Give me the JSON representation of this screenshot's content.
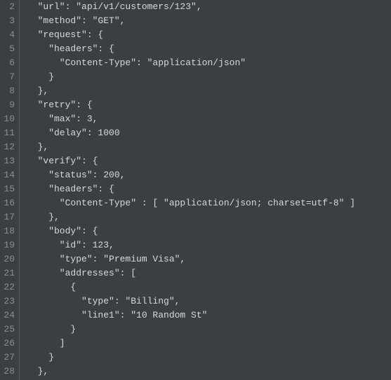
{
  "first_line_number": 2,
  "lines": [
    {
      "indent": 1,
      "text": "\"url\": \"api/v1/customers/123\","
    },
    {
      "indent": 1,
      "text": "\"method\": \"GET\","
    },
    {
      "indent": 1,
      "text": "\"request\": {"
    },
    {
      "indent": 2,
      "text": "\"headers\": {"
    },
    {
      "indent": 3,
      "text": "\"Content-Type\": \"application/json\""
    },
    {
      "indent": 2,
      "text": "}"
    },
    {
      "indent": 1,
      "text": "},"
    },
    {
      "indent": 1,
      "text": "\"retry\": {"
    },
    {
      "indent": 2,
      "text": "\"max\": 3,"
    },
    {
      "indent": 2,
      "text": "\"delay\": 1000"
    },
    {
      "indent": 1,
      "text": "},"
    },
    {
      "indent": 1,
      "text": "\"verify\": {"
    },
    {
      "indent": 2,
      "text": "\"status\": 200,"
    },
    {
      "indent": 2,
      "text": "\"headers\": {"
    },
    {
      "indent": 3,
      "text": "\"Content-Type\" : [ \"application/json; charset=utf-8\" ]"
    },
    {
      "indent": 2,
      "text": "},"
    },
    {
      "indent": 2,
      "text": "\"body\": {"
    },
    {
      "indent": 3,
      "text": "\"id\": 123,"
    },
    {
      "indent": 3,
      "text": "\"type\": \"Premium Visa\","
    },
    {
      "indent": 3,
      "text": "\"addresses\": ["
    },
    {
      "indent": 4,
      "text": "{"
    },
    {
      "indent": 5,
      "text": "\"type\": \"Billing\","
    },
    {
      "indent": 5,
      "text": "\"line1\": \"10 Random St\""
    },
    {
      "indent": 4,
      "text": "}"
    },
    {
      "indent": 3,
      "text": "]"
    },
    {
      "indent": 2,
      "text": "}"
    },
    {
      "indent": 1,
      "text": "},"
    }
  ],
  "indent_unit": "  "
}
